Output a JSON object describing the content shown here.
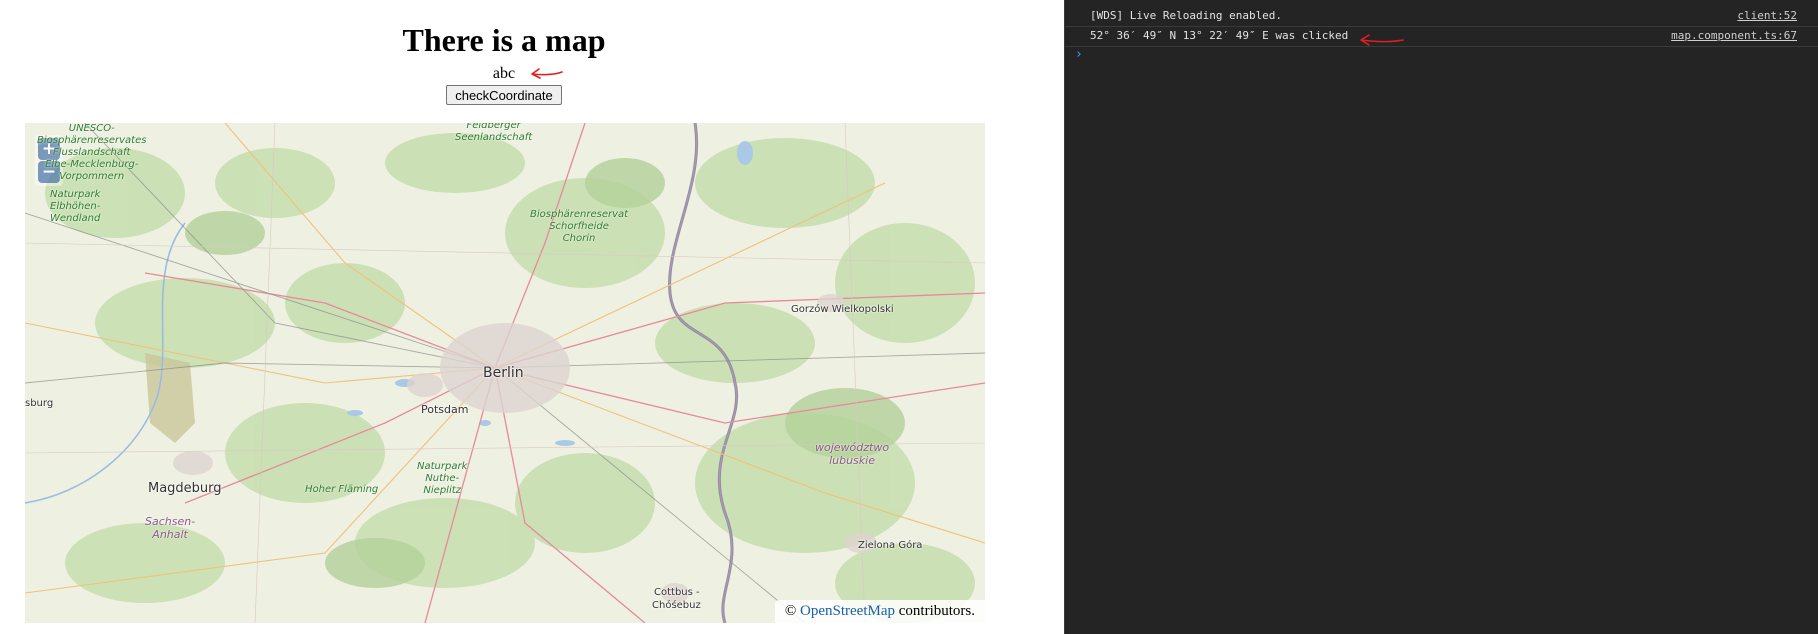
{
  "page": {
    "title": "There is a map",
    "coordinate_text": "abc",
    "check_button_label": "checkCoordinate"
  },
  "map": {
    "zoom_in": "+",
    "zoom_out": "−",
    "attribution_prefix": "©",
    "attribution_link": "OpenStreetMap",
    "attribution_suffix": "contributors.",
    "cities": {
      "berlin": "Berlin",
      "potsdam": "Potsdam",
      "magdeburg": "Magdeburg",
      "gorzow": "Gorzów Wielkopolski",
      "zielona_gora": "Zielona Góra",
      "cottbus": "Cottbus -",
      "chosebuz": "Chóśebuz",
      "hamburg_partial": "sburg"
    },
    "parks": {
      "unesco": [
        "UNESCO-",
        "Biosphärenreservates",
        "Flusslandschaft",
        "Elbe-Mecklenburg-",
        "Vorpommern"
      ],
      "elbhoehen": [
        "Naturpark",
        "Elbhöhen-",
        "Wendland"
      ],
      "feldberger": [
        "Feldberger",
        "Seenlandschaft"
      ],
      "schorfheide": [
        "Biosphärenreservat",
        "Schorfheide",
        "Chorin"
      ],
      "hoher_flaeming": [
        "Hoher Fläming"
      ],
      "nuthe": [
        "Naturpark",
        "Nuthe-",
        "Nieplitz"
      ]
    },
    "regions": {
      "lubuskie": [
        "województwo",
        "lubuskie"
      ],
      "sachsen_anhalt": [
        "Sachsen-",
        "Anhalt"
      ]
    }
  },
  "console": {
    "rows": [
      {
        "message": "[WDS] Live Reloading enabled.",
        "source": "client:52"
      },
      {
        "message": "52° 36′ 49″ N 13° 22′ 49″ E was clicked",
        "source": "map.component.ts:67"
      }
    ],
    "prompt_symbol": "›"
  },
  "colors": {
    "annotation_arrow": "#e02020",
    "console_background": "#242424",
    "link": "#1a5fa8",
    "park_text": "#2e7d32"
  }
}
